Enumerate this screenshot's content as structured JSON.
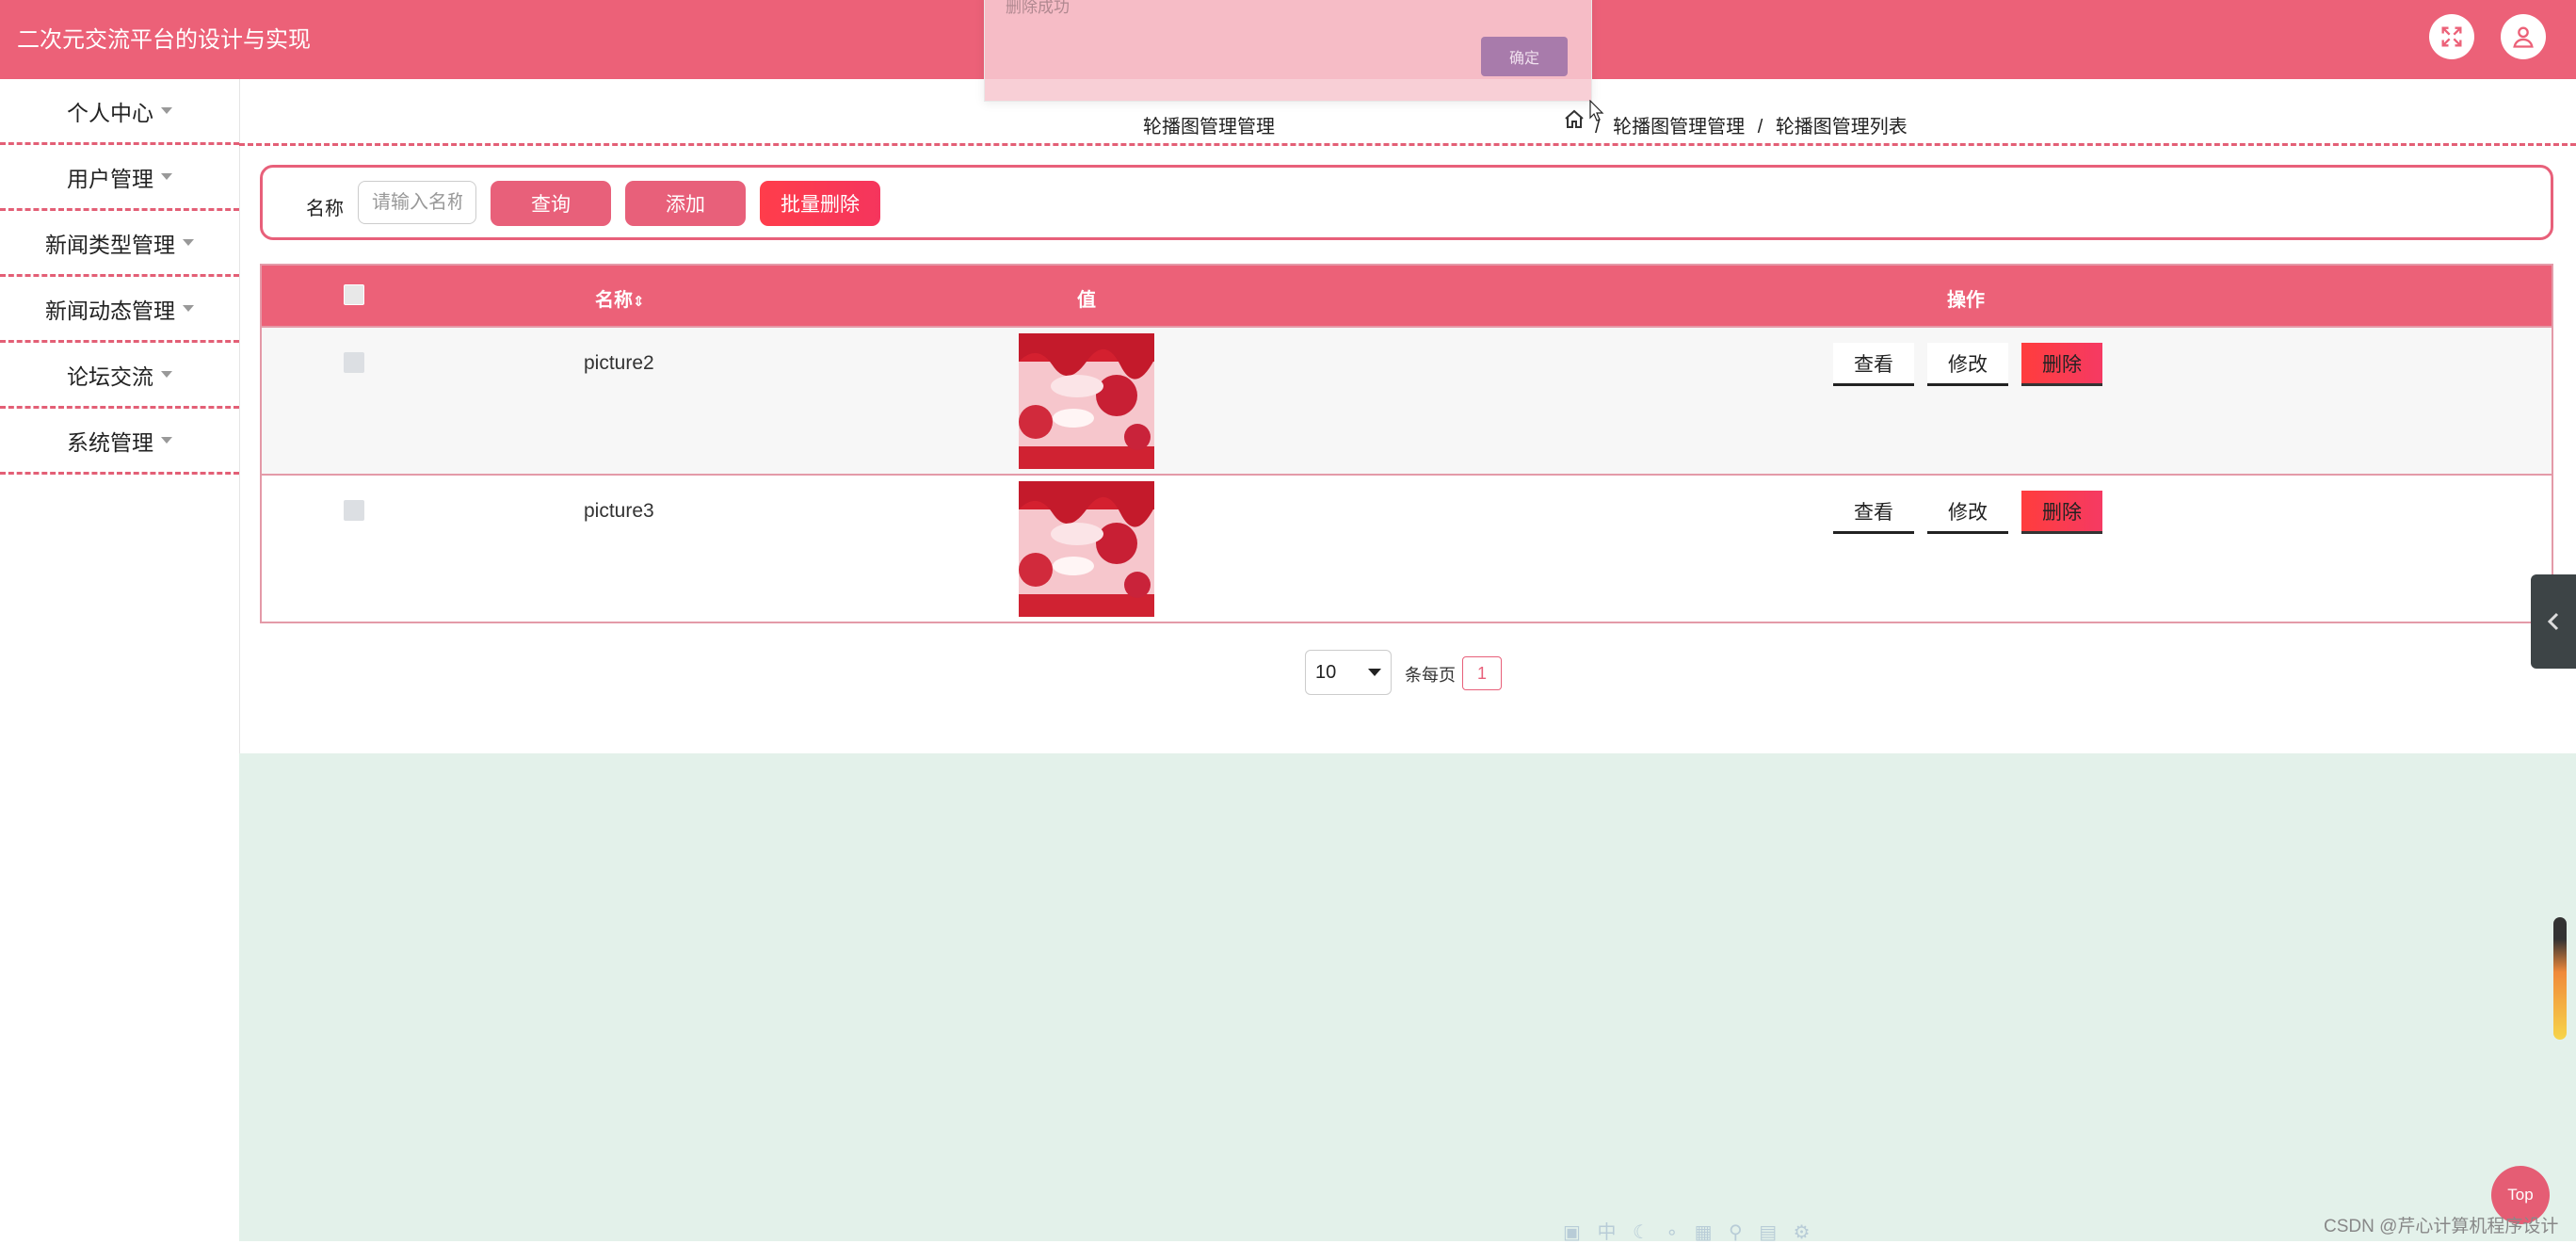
{
  "app": {
    "title": "二次元交流平台的设计与实现"
  },
  "sidebar": {
    "items": [
      {
        "label": "个人中心"
      },
      {
        "label": "用户管理"
      },
      {
        "label": "新闻类型管理"
      },
      {
        "label": "新闻动态管理"
      },
      {
        "label": "论坛交流"
      },
      {
        "label": "系统管理"
      }
    ]
  },
  "breadcrumb": {
    "page_title": "轮播图管理管理",
    "path": [
      "轮播图管理管理",
      "轮播图管理列表"
    ],
    "separator": "/",
    "home_icon": "home-icon"
  },
  "search": {
    "label": "名称",
    "placeholder": "请输入名称",
    "query_label": "查询",
    "add_label": "添加",
    "batch_delete_label": "批量删除"
  },
  "table": {
    "headers": {
      "name": "名称",
      "sort_icon": "⇕",
      "value": "值",
      "ops": "操作"
    },
    "rows": [
      {
        "name": "picture2",
        "view": "查看",
        "edit": "修改",
        "delete": "删除"
      },
      {
        "name": "picture3",
        "view": "查看",
        "edit": "修改",
        "delete": "删除"
      }
    ]
  },
  "pagination": {
    "page_size": "10",
    "per_page_label": "条每页",
    "current_page": "1"
  },
  "toast": {
    "message": "删除成功",
    "ok_label": "确定"
  },
  "widgets": {
    "top_label": "Top",
    "watermark": "CSDN @芹心计算机程序设计"
  },
  "colors": {
    "primary": "#ec6178",
    "danger": "#ff3d4b",
    "mint_bg": "#e3f1ea"
  }
}
